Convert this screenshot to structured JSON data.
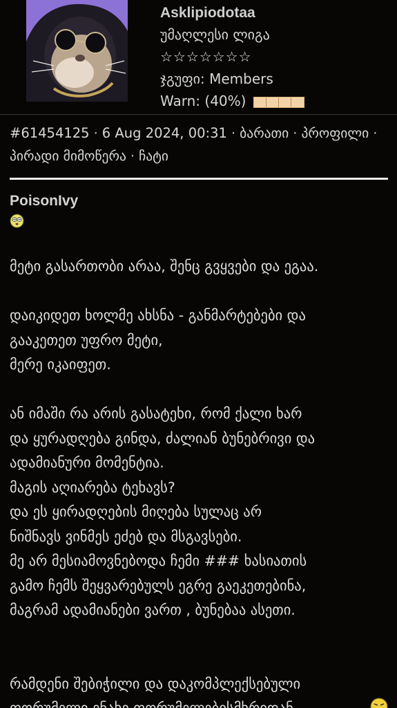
{
  "profile": {
    "username": "Asklipiodotaa",
    "rank": "უმაღლესი ლიგა",
    "stars": "☆☆☆☆☆☆☆",
    "group_label": "ჯგუფი: Members",
    "warn_label": "Warn: (40%)",
    "warn_level": 0.4
  },
  "meta": {
    "post_id": "#61454125",
    "datetime": "6 Aug 2024, 00:31",
    "reply": "ბარათი",
    "profile_link": "პროფილი",
    "pm": "პირადი მიმოწერა",
    "chat": "ჩატი",
    "separator": "·"
  },
  "quote": {
    "author": "PoisonIvy"
  },
  "post": {
    "p1": [
      "მეტი გასართობი არაა, შენც გვყვები და ეგაა."
    ],
    "p2": [
      "დაიკიდეთ ხოლმე ახსნა - განმარტებები და",
      "გააკეთეთ უფრო მეტი,",
      "მერე იკაიფეთ."
    ],
    "p3": [
      "ან იმაში რა არის გასატეხი, რომ ქალი ხარ",
      "და ყურადღება გინდა, ძალიან ბუნებრივი და",
      "ადამიანური მომენტია.",
      "მაგის აღიარება ტეხავს?",
      "და ეს ყირადღების მიღება სულაც არ",
      "ნიშნავს ვინმეს ეძებ და მსგავსები.",
      "მე არ მესიამოვნებოდა ჩემი ### ხასიათის",
      "გამო ჩემს შეყვარებულს ეგრე გაეკეთებინა,",
      "მაგრამ ადამიანები ვართ , ბუნებაა ასეთი."
    ],
    "p4": [
      "რამდენი შებიჭილი და დაკომპლექსებული",
      "ფორუმელი ენახე ფორუმელებისმხრიდან"
    ]
  }
}
